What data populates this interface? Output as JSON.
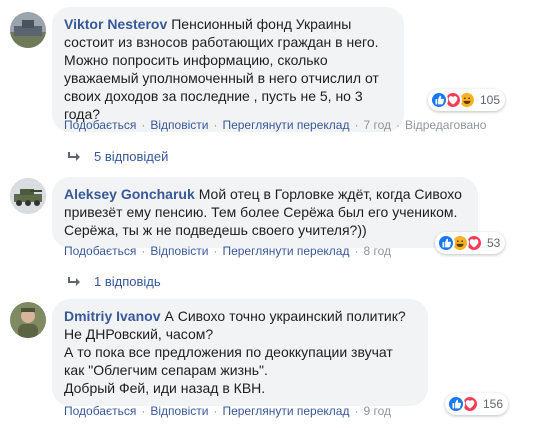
{
  "comments": [
    {
      "author": "Viktor Nesterov",
      "text": "Пенсионный фонд Украины состоит из взносов работающих граждан в него. Можно попросить информацию, сколько уважаемый уполномоченный в него отчислил от своих доходов за последние , пусть не 5, но 3 года?",
      "reaction_count": "105",
      "reactions": [
        "like-icon",
        "love-icon",
        "haha-icon"
      ],
      "like_label": "Подобається",
      "reply_label": "Відповісти",
      "translate_label": "Переглянути переклад",
      "time": "7 год",
      "edited_label": "Відредаговано",
      "replies_label": "5 відповідей"
    },
    {
      "author": "Aleksey Goncharuk",
      "text": "Мой отец в Горловке ждёт, когда Сивохо привезёт ему пенсию. Тем более Серёжа был его учеником. Серёжа, ты ж не подведешь своего учителя?))",
      "reaction_count": "53",
      "reactions": [
        "like-icon",
        "haha-icon",
        "love-icon"
      ],
      "like_label": "Подобається",
      "reply_label": "Відповісти",
      "translate_label": "Переглянути переклад",
      "time": "8 год",
      "replies_label": "1 відповідь"
    },
    {
      "author": "Dmitriy Ivanov",
      "text_lines": [
        "А Сивохо точно украинский политик? Не ДНРовский, часом?",
        "А то пока все предложения по деоккупации звучат как \"Облегчим сепарам жизнь\".",
        "Добрый Фей, иди назад в КВН."
      ],
      "reaction_count": "156",
      "reactions": [
        "like-icon",
        "love-icon"
      ],
      "like_label": "Подобається",
      "reply_label": "Відповісти",
      "translate_label": "Переглянути переклад",
      "time": "9 год"
    }
  ],
  "colors": {
    "author": "#385898",
    "bubble": "#f2f3f5",
    "like": "#1877f2",
    "love": "#f33e58",
    "haha": "#f7b125",
    "meta": "#90949c"
  }
}
